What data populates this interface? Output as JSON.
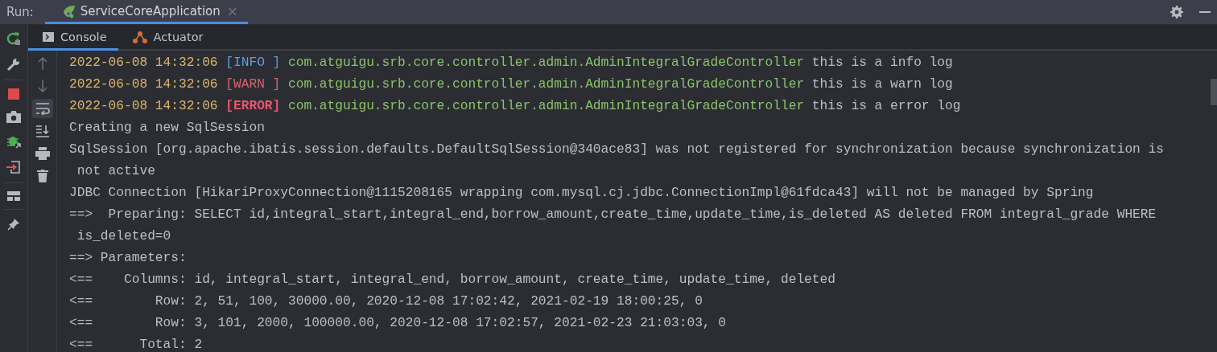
{
  "run_bar": {
    "label": "Run:",
    "tabs": [
      {
        "label": "ServiceCoreApplication",
        "selected": true,
        "close": "×"
      }
    ]
  },
  "tool_tabs": [
    {
      "label": "Console",
      "kind": "console",
      "selected": true
    },
    {
      "label": "Actuator",
      "kind": "actuator",
      "selected": false
    }
  ],
  "lines": [
    {
      "kind": "info",
      "time": "2022-06-08 14:32:06",
      "level_text": "[INFO ]",
      "logger": "com.atguigu.srb.core.controller.admin.AdminIntegralGradeController",
      "message": "this is a info log"
    },
    {
      "kind": "warn",
      "time": "2022-06-08 14:32:06",
      "level_text": "[WARN ]",
      "logger": "com.atguigu.srb.core.controller.admin.AdminIntegralGradeController",
      "message": "this is a warn log"
    },
    {
      "kind": "error",
      "time": "2022-06-08 14:32:06",
      "level_text": "[ERROR]",
      "logger": "com.atguigu.srb.core.controller.admin.AdminIntegralGradeController",
      "message": "this is a error log"
    },
    {
      "kind": "plain",
      "text": "Creating a new SqlSession"
    },
    {
      "kind": "plain",
      "text": "SqlSession [org.apache.ibatis.session.defaults.DefaultSqlSession@340ace83] was not registered for synchronization because synchronization is"
    },
    {
      "kind": "plain",
      "text": " not active"
    },
    {
      "kind": "plain",
      "text": "JDBC Connection [HikariProxyConnection@1115208165 wrapping com.mysql.cj.jdbc.ConnectionImpl@61fdca43] will not be managed by Spring"
    },
    {
      "kind": "plain",
      "text": "==>  Preparing: SELECT id,integral_start,integral_end,borrow_amount,create_time,update_time,is_deleted AS deleted FROM integral_grade WHERE"
    },
    {
      "kind": "plain",
      "text": " is_deleted=0"
    },
    {
      "kind": "plain",
      "text": "==> Parameters: "
    },
    {
      "kind": "plain",
      "text": "<==    Columns: id, integral_start, integral_end, borrow_amount, create_time, update_time, deleted"
    },
    {
      "kind": "plain",
      "text": "<==        Row: 2, 51, 100, 30000.00, 2020-12-08 17:02:42, 2021-02-19 18:00:25, 0"
    },
    {
      "kind": "plain",
      "text": "<==        Row: 3, 101, 2000, 100000.00, 2020-12-08 17:02:57, 2021-02-23 21:03:03, 0"
    },
    {
      "kind": "plain",
      "text": "<==      Total: 2"
    }
  ]
}
